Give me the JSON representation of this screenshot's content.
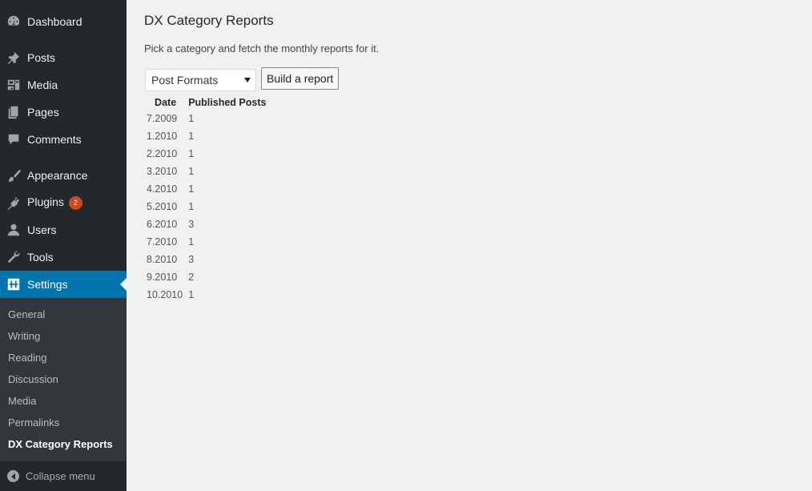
{
  "sidebar": {
    "items": [
      {
        "label": "Dashboard",
        "icon": "dashboard-icon"
      },
      {
        "label": "Posts",
        "icon": "pin-icon"
      },
      {
        "label": "Media",
        "icon": "media-icon"
      },
      {
        "label": "Pages",
        "icon": "pages-icon"
      },
      {
        "label": "Comments",
        "icon": "comment-icon"
      },
      {
        "label": "Appearance",
        "icon": "brush-icon"
      },
      {
        "label": "Plugins",
        "icon": "plugin-icon",
        "badge": "2"
      },
      {
        "label": "Users",
        "icon": "user-icon"
      },
      {
        "label": "Tools",
        "icon": "wrench-icon"
      },
      {
        "label": "Settings",
        "icon": "settings-icon",
        "current": true
      }
    ],
    "submenu": [
      {
        "label": "General"
      },
      {
        "label": "Writing"
      },
      {
        "label": "Reading"
      },
      {
        "label": "Discussion"
      },
      {
        "label": "Media"
      },
      {
        "label": "Permalinks"
      },
      {
        "label": "DX Category Reports",
        "current": true
      }
    ],
    "collapse_label": "Collapse menu"
  },
  "main": {
    "title": "DX Category Reports",
    "intro": "Pick a category and fetch the monthly reports for it.",
    "category_select": {
      "selected": "Post Formats"
    },
    "build_button": "Build a report",
    "table": {
      "headers": [
        "Date",
        "Published Posts"
      ],
      "rows": [
        [
          "7.2009",
          "1"
        ],
        [
          "1.2010",
          "1"
        ],
        [
          "2.2010",
          "1"
        ],
        [
          "3.2010",
          "1"
        ],
        [
          "4.2010",
          "1"
        ],
        [
          "5.2010",
          "1"
        ],
        [
          "6.2010",
          "3"
        ],
        [
          "7.2010",
          "1"
        ],
        [
          "8.2010",
          "3"
        ],
        [
          "9.2010",
          "2"
        ],
        [
          "10.2010",
          "1"
        ]
      ]
    }
  },
  "colors": {
    "sidebar_bg": "#23282d",
    "submenu_bg": "#32373c",
    "accent": "#0073aa",
    "badge": "#ca4a1f",
    "content_bg": "#f1f1f1"
  }
}
